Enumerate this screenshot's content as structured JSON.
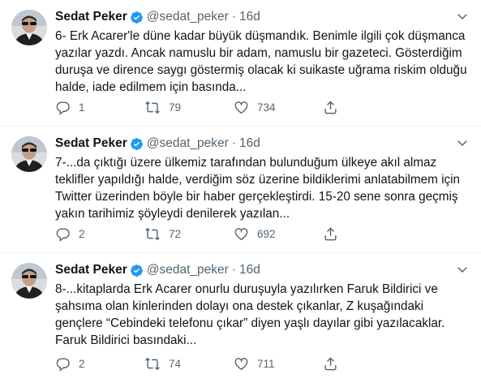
{
  "tweets": [
    {
      "name": "Sedat Peker",
      "handle": "@sedat_peker",
      "separator": "·",
      "time": "16d",
      "text": "6- Erk Acarer'le düne kadar büyük düşmandık. Benimle ilgili çok düşmanca yazılar yazdı. Ancak namuslu bir adam, namuslu bir gazeteci. Gösterdiğim duruşa ve dirence saygı göstermiş olacak ki suikaste uğrama riskim olduğu halde, iade edilmem için basında...",
      "replies": "1",
      "retweets": "79",
      "likes": "734"
    },
    {
      "name": "Sedat Peker",
      "handle": "@sedat_peker",
      "separator": "·",
      "time": "16d",
      "text": "7-...da çıktığı üzere ülkemiz tarafından bulunduğum ülkeye akıl almaz teklifler yapıldığı halde, verdiğim söz üzerine bildiklerimi anlatabilmem için Twitter üzerinden böyle bir haber gerçekleştirdi. 15-20 sene sonra geçmiş yakın tarihimiz şöyleydi denilerek yazılan...",
      "replies": "2",
      "retweets": "72",
      "likes": "692"
    },
    {
      "name": "Sedat Peker",
      "handle": "@sedat_peker",
      "separator": "·",
      "time": "16d",
      "text": "8-...kitaplarda Erk Acarer onurlu duruşuyla yazılırken Faruk Bildirici ve şahsıma olan kinlerinden dolayı ona destek çıkanlar, Z kuşağındaki gençlere “Cebindeki telefonu çıkar” diyen yaşlı dayılar gibi yazılacaklar. Faruk Bildirici basındaki...",
      "replies": "2",
      "retweets": "74",
      "likes": "711"
    }
  ],
  "colors": {
    "text": "#0f1419",
    "muted": "#536471",
    "verified": "#1d9bf0",
    "divider": "#eff3f4"
  },
  "icons": [
    "reply-icon",
    "retweet-icon",
    "like-icon",
    "share-icon",
    "verified-badge-icon",
    "more-icon"
  ]
}
